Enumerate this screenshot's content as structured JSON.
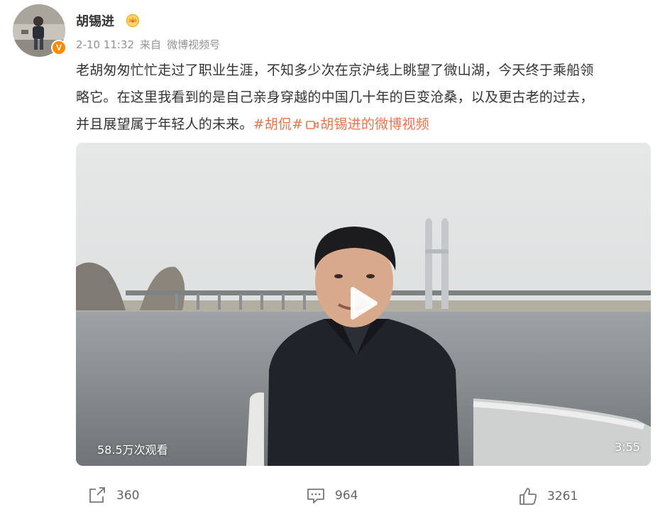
{
  "user": {
    "name": "胡锡进",
    "verified_badge": "V",
    "icons": {
      "avatar": "avatar-photo",
      "crown": "crown-icon",
      "verified": "verified-badge-icon"
    }
  },
  "meta": {
    "timestamp": "2-10 11:32",
    "source_prefix": "来自",
    "source_name": "微博视频号"
  },
  "post": {
    "lines": [
      "老胡匆匆忙忙走过了职业生涯，不知多少次在京沪线上眺望了微山湖，今天终于乘船领",
      "略它。在这里我看到的是自己亲身穿越的中国几十年的巨变沧桑，以及更古老的过去，",
      "并且展望属于年轻人的未来。"
    ],
    "hashtag": "#胡侃#",
    "video_link_text": "胡锡进的微博视频",
    "link_color": "#eb7350"
  },
  "video": {
    "views": "58.5万次观看",
    "duration": "3:55",
    "play_icon": "play-icon"
  },
  "actions": {
    "repost": {
      "count": "360",
      "icon": "share-icon"
    },
    "comment": {
      "count": "964",
      "icon": "comment-icon"
    },
    "like": {
      "count": "3261",
      "icon": "like-icon"
    }
  }
}
